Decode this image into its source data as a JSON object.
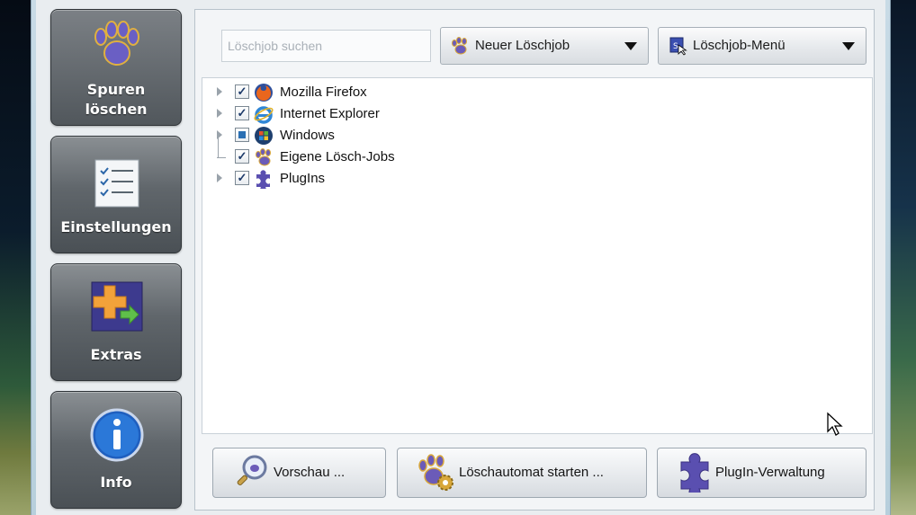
{
  "sidebar": {
    "items": [
      {
        "label_line1": "Spuren",
        "label_line2": "löschen",
        "icon": "paw-icon",
        "active": true
      },
      {
        "label": "Einstellungen",
        "icon": "checklist-icon"
      },
      {
        "label": "Extras",
        "icon": "extras-icon"
      },
      {
        "label": "Info",
        "icon": "info-icon"
      }
    ]
  },
  "toolbar": {
    "search_placeholder": "Löschjob suchen",
    "new_job_label": "Neuer Löschjob",
    "job_menu_label": "Löschjob-Menü"
  },
  "tree": {
    "items": [
      {
        "label": "Mozilla Firefox",
        "icon": "firefox-icon",
        "state": "checked",
        "expandable": true
      },
      {
        "label": "Internet Explorer",
        "icon": "internet-explorer-icon",
        "state": "checked",
        "expandable": true
      },
      {
        "label": "Windows",
        "icon": "windows-icon",
        "state": "partial",
        "expandable": true
      },
      {
        "label": "Eigene Lösch-Jobs",
        "icon": "paw-icon",
        "state": "checked",
        "expandable": false
      },
      {
        "label": "PlugIns",
        "icon": "puzzle-icon",
        "state": "checked",
        "expandable": true
      }
    ]
  },
  "bottom_buttons": {
    "preview_label": "Vorschau ...",
    "auto_label": "Löschautomat starten ...",
    "plugin_label": "PlugIn-Verwaltung"
  },
  "colors": {
    "sidebar_button": "#5c6267",
    "accent_blue": "#2a6fb3",
    "paw_purple": "#6b5bb8"
  }
}
